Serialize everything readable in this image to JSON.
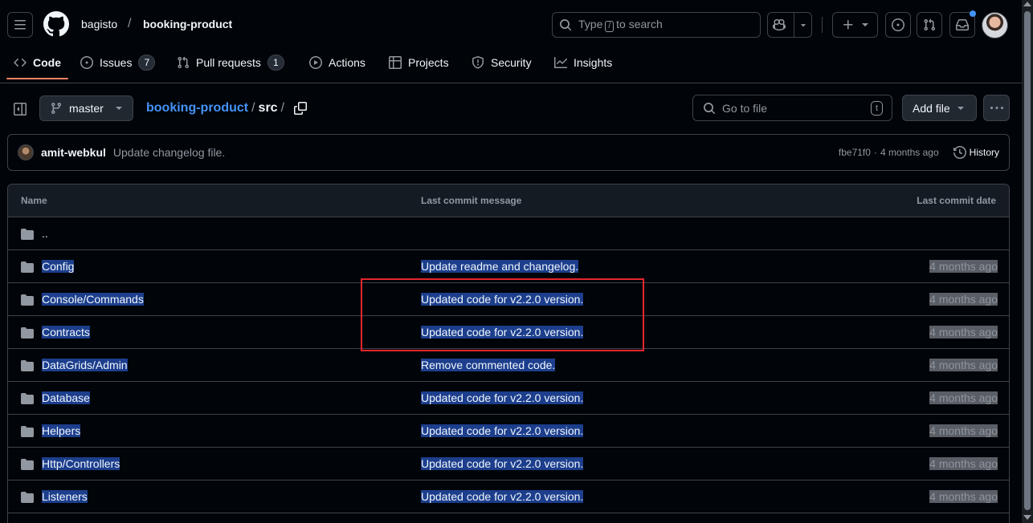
{
  "header": {
    "owner": "bagisto",
    "slash": "/",
    "repo": "booking-product",
    "search_prefix": "Type",
    "search_key": "/",
    "search_suffix": "to search"
  },
  "nav": {
    "tabs": [
      {
        "label": "Code",
        "active": true
      },
      {
        "label": "Issues",
        "count": "7"
      },
      {
        "label": "Pull requests",
        "count": "1"
      },
      {
        "label": "Actions"
      },
      {
        "label": "Projects"
      },
      {
        "label": "Security"
      },
      {
        "label": "Insights"
      }
    ]
  },
  "pathbar": {
    "branch": "master",
    "repo_link": "booking-product",
    "sep1": "/",
    "current": "src",
    "sep2": "/",
    "goto_placeholder": "Go to file",
    "goto_key": "t",
    "add_file": "Add file"
  },
  "commit": {
    "author": "amit-webkul",
    "message": "Update changelog file.",
    "sha": "fbe71f0",
    "dot": "·",
    "time": "4 months ago",
    "history": "History"
  },
  "table": {
    "headers": {
      "name": "Name",
      "message": "Last commit message",
      "date": "Last commit date"
    },
    "parent": "..",
    "rows": [
      {
        "name": "Config",
        "message": "Update readme and changelog.",
        "date": "4 months ago"
      },
      {
        "name": "Console/Commands",
        "message": "Updated code for v2.2.0 version.",
        "date": "4 months ago"
      },
      {
        "name": "Contracts",
        "message": "Updated code for v2.2.0 version.",
        "date": "4 months ago"
      },
      {
        "name": "DataGrids/Admin",
        "message": "Remove commented code.",
        "date": "4 months ago"
      },
      {
        "name": "Database",
        "message": "Updated code for v2.2.0 version.",
        "date": "4 months ago"
      },
      {
        "name": "Helpers",
        "message": "Updated code for v2.2.0 version.",
        "date": "4 months ago"
      },
      {
        "name": "Http/Controllers",
        "message": "Updated code for v2.2.0 version.",
        "date": "4 months ago"
      },
      {
        "name": "Listeners",
        "message": "Updated code for v2.2.0 version.",
        "date": "4 months ago"
      }
    ]
  },
  "colors": {
    "background": "#010409",
    "border": "#3d444d",
    "link": "#4493f8",
    "accent": "#f78166",
    "selection": "#1c3e8c",
    "annotation": "#e5262d"
  }
}
